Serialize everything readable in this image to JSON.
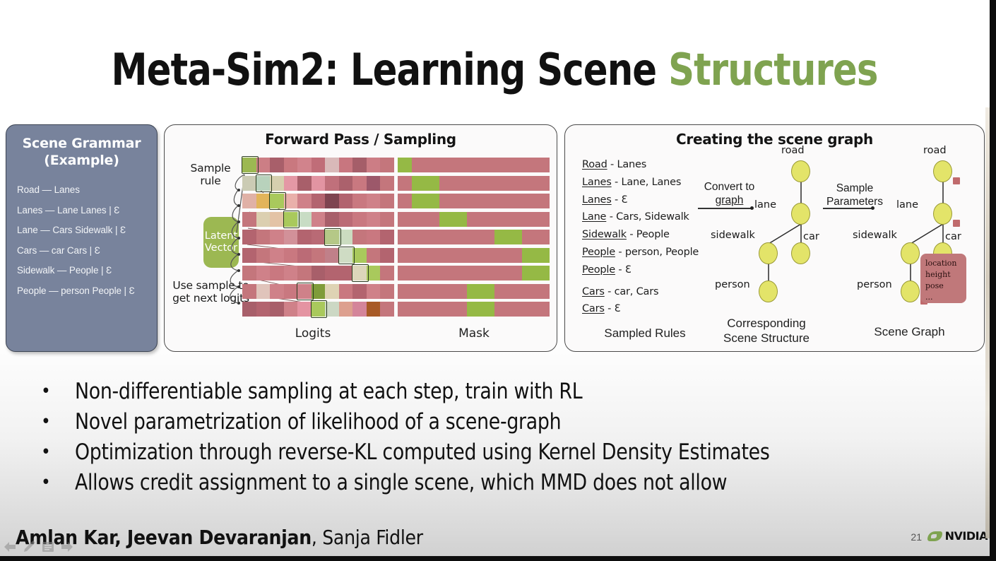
{
  "slide": {
    "title_main": "Meta-Sim2: Learning Scene ",
    "title_accent": "Structures",
    "page_number": "21",
    "authors_bold": "Amlan Kar, Jeevan Devaranjan",
    "authors_rest": ", Sanja Fidler",
    "brand": "NVIDIA"
  },
  "grammar": {
    "title_line1": "Scene Grammar",
    "title_line2": "(Example)",
    "rules": [
      "Road — Lanes",
      "Lanes — Lane Lanes  | Ɛ",
      "Lane — Cars Sidewalk  | Ɛ",
      "Cars — car Cars  | Ɛ",
      "Sidewalk — People  | Ɛ",
      "People — person People  | Ɛ"
    ]
  },
  "forward": {
    "title": "Forward Pass / Sampling",
    "sample_rule_label": "Sample rule",
    "use_sample_label": "Use sample to get next logits",
    "latent_label_line1": "Latent",
    "latent_label_line2": "Vector",
    "logits_axis_label": "Logits",
    "mask_axis_label": "Mask"
  },
  "graph": {
    "title": "Creating the scene graph",
    "sampled_rules": [
      {
        "lhs": "Road",
        "rhs": " - Lanes"
      },
      {
        "lhs": "Lanes",
        "rhs": " - Lane, Lanes"
      },
      {
        "lhs": "Lanes",
        "rhs": " - Ɛ"
      },
      {
        "lhs": "Lane",
        "rhs": " - Cars, Sidewalk"
      },
      {
        "lhs": "Sidewalk",
        "rhs": " - People"
      },
      {
        "lhs": "People",
        "rhs": " - person, People"
      },
      {
        "lhs": "People",
        "rhs": " - Ɛ"
      },
      {
        "lhs": "Cars",
        "rhs": " - car, Cars"
      },
      {
        "lhs": "Cars",
        "rhs": " - Ɛ"
      }
    ],
    "sampled_rules_caption": "Sampled Rules",
    "convert_caption_line1": "Convert to",
    "convert_caption_line2": "graph",
    "sample_params_caption_line1": "Sample",
    "sample_params_caption_line2": "Parameters",
    "scene_structure_caption_line1": "Corresponding",
    "scene_structure_caption_line2": "Scene Structure",
    "scene_graph_caption": "Scene Graph",
    "node_labels": {
      "road": "road",
      "lane": "lane",
      "car": "car",
      "sidewalk": "sidewalk",
      "person": "person"
    },
    "param_box_lines": [
      "location",
      "height",
      "pose",
      "..."
    ]
  },
  "bullets": [
    "Non-differentiable sampling at each step, train with RL",
    "Novel parametrization of likelihood of a scene-graph",
    "Optimization through reverse-KL computed using Kernel Density Estimates",
    "Allows credit assignment to a single scene, which MMD does not allow"
  ],
  "colors": {
    "accent_green": "#7fa350",
    "grammar_panel": "#78839c",
    "latent_green": "#9cb852",
    "mask_red": "#c4767c",
    "mask_green": "#95b945",
    "node_yellow": "#e3e469",
    "param_red": "#c0787a"
  },
  "chart_data": {
    "type": "heatmap",
    "title": "Forward Pass / Sampling",
    "logits_rows": [
      {
        "selected_index": 0,
        "cells": [
          "#9cb852",
          "#cc7e85",
          "#a85f6a",
          "#c9787f",
          "#d1838c",
          "#c06d78",
          "#d9b9b9",
          "#c8767f",
          "#a55e69",
          "#cc7d85",
          "#c4767c"
        ]
      },
      {
        "selected_index": 1,
        "cells": [
          "#cbcbb4",
          "#b8d2bc",
          "#d6cfae",
          "#e498a5",
          "#a85f6a",
          "#e294a2",
          "#c0707b",
          "#ab616c",
          "#c97880",
          "#9c586a",
          "#c4767c"
        ]
      },
      {
        "selected_index": 2,
        "cells": [
          "#e0b1a6",
          "#e2b45a",
          "#a9c95c",
          "#e9b0aa",
          "#cf8189",
          "#b3646f",
          "#7e4450",
          "#b2636f",
          "#c97880",
          "#cf8189",
          "#c4767c"
        ]
      },
      {
        "selected_index": 3,
        "cells": [
          "#c4767c",
          "#dbcfb0",
          "#e3c3a6",
          "#a9c95c",
          "#c8dcc4",
          "#cf8189",
          "#a85f6a",
          "#bb6b76",
          "#c97880",
          "#cf8189",
          "#c4767c"
        ]
      },
      {
        "selected_index": 6,
        "cells": [
          "#b3646f",
          "#c4767c",
          "#cf8189",
          "#d29199",
          "#b3646f",
          "#b96a75",
          "#b5c887",
          "#cbdcc0",
          "#c4767c",
          "#c97880",
          "#b3646f"
        ]
      },
      {
        "selected_index": 7,
        "cells": [
          "#b3646f",
          "#c4767c",
          "#cf8189",
          "#c97880",
          "#bb6b76",
          "#c4767c",
          "#c08089",
          "#cfdcc4",
          "#a9c95c",
          "#c4767c",
          "#b3646f"
        ]
      },
      {
        "selected_index": 8,
        "cells": [
          "#c4767c",
          "#cf8189",
          "#c97880",
          "#cf8189",
          "#c4767c",
          "#a85f6a",
          "#b3646f",
          "#b3646f",
          "#dcd6ba",
          "#a9c95c",
          "#c4767c"
        ]
      },
      {
        "selected_index": 4,
        "cells": [
          "#c4767c",
          "#e0c4bb",
          "#cf8189",
          "#c97880",
          "#cf8189",
          "#7f9c3a",
          "#ded3b4",
          "#c97880",
          "#b3646f",
          "#cf8189",
          "#c4767c"
        ]
      },
      {
        "selected_index": 5,
        "cells": [
          "#a85f6a",
          "#b3646f",
          "#a85f6a",
          "#cf8189",
          "#e494a2",
          "#a9c95c",
          "#ccd8c4",
          "#dda08f",
          "#d4859a",
          "#a85a26",
          "#c4767c"
        ]
      }
    ],
    "mask_rows": [
      {
        "green_start": 0,
        "green_width": 1
      },
      {
        "green_start": 1,
        "green_width": 2
      },
      {
        "green_start": 1,
        "green_width": 2
      },
      {
        "green_start": 3,
        "green_width": 2
      },
      {
        "green_start": 7,
        "green_width": 2
      },
      {
        "green_start": 9,
        "green_width": 2
      },
      {
        "green_start": 9,
        "green_width": 2
      },
      {
        "green_start": 5,
        "green_width": 2
      },
      {
        "green_start": 5,
        "green_width": 2
      }
    ],
    "n_columns": 11,
    "n_rows": 9
  }
}
